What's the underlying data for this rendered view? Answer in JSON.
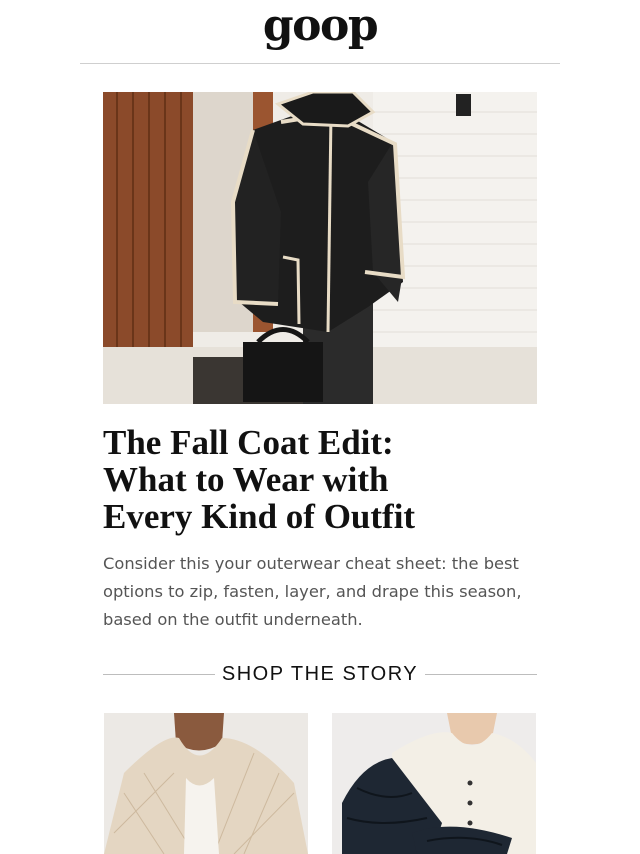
{
  "header": {
    "logo_text": "goop"
  },
  "hero": {
    "image_alt": "Woman in black coat with cream trim walking with black bag",
    "colors": {
      "wood": "#8b4a2a",
      "wall": "#f2f0ec",
      "coat": "#1c1c1c",
      "trim": "#e8dcc6"
    }
  },
  "article": {
    "headline_lines": [
      "The Fall Coat Edit:",
      "What to Wear with",
      "Every Kind of Outfit"
    ],
    "dek_lines": [
      "Consider this your outerwear cheat sheet: the best",
      "options to zip, fasten, layer, and drape this season,",
      "based on the outfit underneath."
    ]
  },
  "shop": {
    "label": "SHOP THE STORY",
    "products": [
      {
        "image_alt": "Cream quilted jacket"
      },
      {
        "image_alt": "Navy puffer over cream cardigan"
      }
    ]
  }
}
